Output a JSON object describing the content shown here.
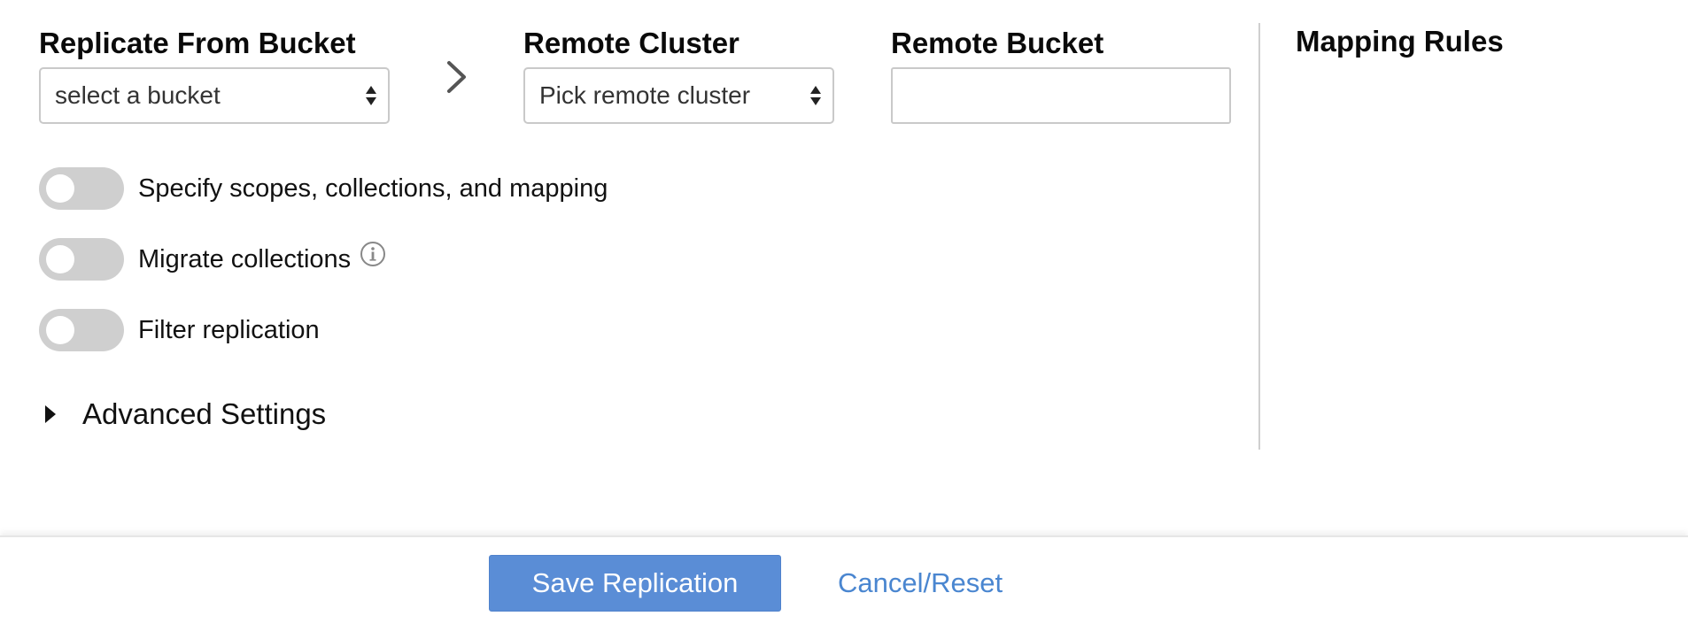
{
  "source": {
    "label": "Replicate From Bucket",
    "selected": "select a bucket"
  },
  "remote_cluster": {
    "label": "Remote Cluster",
    "selected": "Pick remote cluster"
  },
  "remote_bucket": {
    "label": "Remote Bucket",
    "value": ""
  },
  "toggles": [
    {
      "label": "Specify scopes, collections, and mapping",
      "on": false
    },
    {
      "label": "Migrate collections",
      "on": false
    },
    {
      "label": "Filter replication",
      "on": false
    }
  ],
  "advanced": {
    "label": "Advanced Settings",
    "expanded": false
  },
  "mapping": {
    "title": "Mapping Rules"
  },
  "footer": {
    "save_label": "Save Replication",
    "cancel_label": "Cancel/Reset"
  },
  "icons": {
    "arrow_between": "chevron-right-icon",
    "select_arrows": "select-arrows-icon",
    "info": "info-icon",
    "expand": "caret-right-icon"
  },
  "colors": {
    "primary_button": "#5a8dd6",
    "link": "#4a86d0",
    "toggle_off": "#cfcfcf"
  }
}
